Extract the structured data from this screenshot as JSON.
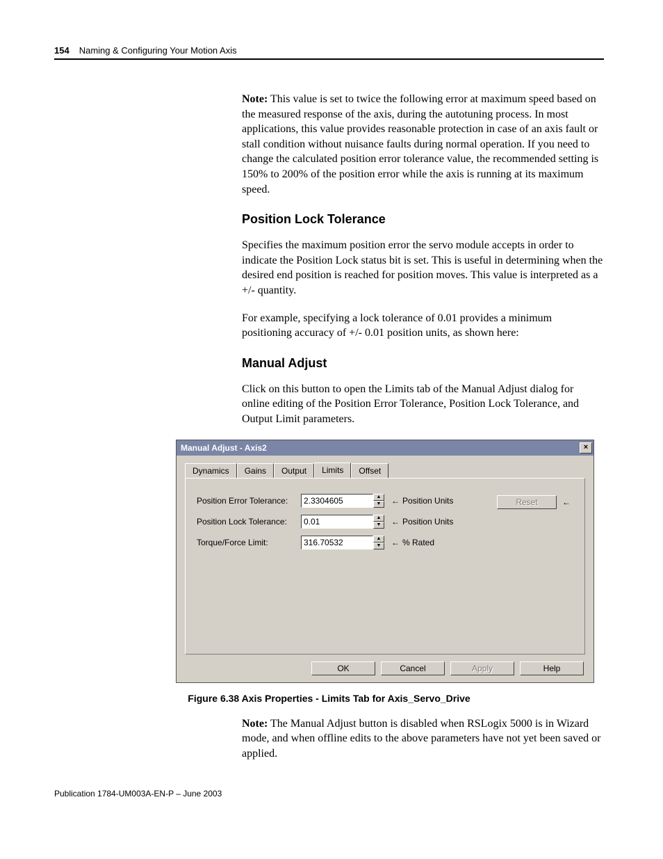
{
  "header": {
    "page_number": "154",
    "section_title": "Naming & Configuring Your Motion Axis"
  },
  "content": {
    "note1": "Note: This value is set to twice the following error at maximum speed based on the measured response of the axis, during the autotuning process. In most applications, this value provides reasonable protection in case of an axis fault or stall condition without nuisance faults during normal operation. If you need to change the calculated position error tolerance value, the recommended setting is 150% to 200% of the position error while the axis is running at its maximum speed.",
    "h_position_lock": "Position Lock Tolerance",
    "p_position_lock_1": "Specifies the maximum position error the servo module accepts in order to indicate the Position Lock status bit is set. This is useful in determining when the desired end position is reached for position moves. This value is interpreted as a +/- quantity.",
    "p_position_lock_2": "For example, specifying a lock tolerance of 0.01 provides a minimum positioning accuracy of +/- 0.01 position units, as shown here:",
    "h_manual_adjust": "Manual Adjust",
    "p_manual_adjust": "Click on this button to open the Limits tab of the Manual Adjust dialog for online editing of the Position Error Tolerance, Position Lock Tolerance, and Output Limit parameters.",
    "figure_caption": "Figure 6.38 Axis Properties - Limits Tab for Axis_Servo_Drive",
    "note2": "Note: The Manual Adjust button is disabled when RSLogix 5000 is in Wizard mode, and when offline edits to the above parameters have not yet been saved or applied."
  },
  "dialog": {
    "title": "Manual Adjust - Axis2",
    "tabs": {
      "dynamics": "Dynamics",
      "gains": "Gains",
      "output": "Output",
      "limits": "Limits",
      "offset": "Offset"
    },
    "rows": {
      "pet": {
        "label": "Position Error Tolerance:",
        "value": "2.3304605",
        "unit": "Position Units"
      },
      "plt": {
        "label": "Position Lock Tolerance:",
        "value": "0.01",
        "unit": "Position Units"
      },
      "tfl": {
        "label": "Torque/Force Limit:",
        "value": "316.70532",
        "unit": "% Rated"
      }
    },
    "reset": "Reset",
    "arrow": "←",
    "buttons": {
      "ok": "OK",
      "cancel": "Cancel",
      "apply": "Apply",
      "help": "Help"
    }
  },
  "footer": {
    "publication": "Publication 1784-UM003A-EN-P – June 2003"
  }
}
